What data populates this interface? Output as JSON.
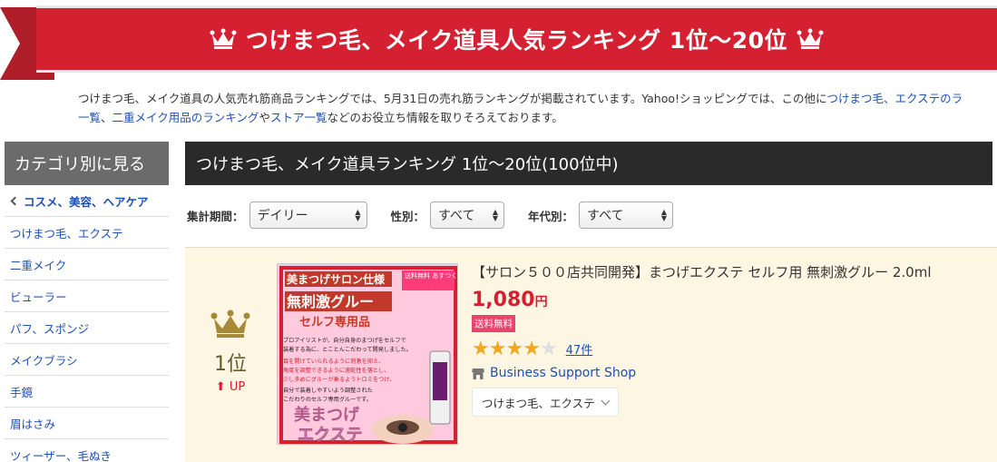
{
  "banner": {
    "title": "つけまつ毛、メイク道具人気ランキング 1位〜20位"
  },
  "description": {
    "line1_text": "つけまつ毛、メイク道具の人気売れ筋商品ランキングでは、5月31日の売れ筋ランキングが掲載されています。Yahoo!ショッピングでは、この他に",
    "line1_link": "つけまつ毛、エクステのラ",
    "line2_link1": "一覧",
    "line2_sep": "、",
    "line2_link2": "二重メイク用品のランキング",
    "line2_mid": "や",
    "line2_link3": "ストア一覧",
    "line2_tail": "などのお役立ち情報を取りそろえております。"
  },
  "sidebar": {
    "heading": "カテゴリ別に見る",
    "parent": "コスメ、美容、ヘアケア",
    "items": [
      "つけまつ毛、エクステ",
      "二重メイク",
      "ビューラー",
      "パフ、スポンジ",
      "メイクブラシ",
      "手鏡",
      "眉はさみ",
      "ツィーザー、毛ぬき"
    ]
  },
  "main": {
    "heading": "つけまつ毛、メイク道具ランキング 1位〜20位(100位中)"
  },
  "filters": {
    "period_label": "集計期間：",
    "period_value": "デイリー",
    "gender_label": "性別：",
    "gender_value": "すべて",
    "age_label": "年代別：",
    "age_value": "すべて"
  },
  "item": {
    "rank": "1位",
    "rank_change": "UP",
    "title": "【サロン５００店共同開発】まつげエクステ セルフ用 無刺激グルー 2.0ml",
    "price": "1,080",
    "price_unit": "円",
    "shipping_badge": "送料無料",
    "rating": 4,
    "rating_max": 5,
    "review_count": "47件",
    "shop_name": "Business Support Shop",
    "category_tag": "つけまつ毛、エクステ",
    "image": {
      "top_label": "美まつげサロン仕様",
      "side_label": "送料無料 あすつく対応",
      "headline": "無刺激グルー",
      "subhead": "セルフ専用品",
      "body1": "プロアイリストが、自分自身のまつげをセルフで",
      "body2": "装着する為に、とことんこだわって開発しました。",
      "body3": "目を開けていられるように刺激を抑え、",
      "body4": "角度を調整できるように速乾性を落とし、",
      "body5": "少し多めにグルーが乗るようトロミをつけ、",
      "body6": "自分で装着しやすいよう調整された",
      "body7": "こだわりのセルフ専用グルーです。",
      "brand1": "美まつげ",
      "brand2": "エクステ"
    }
  },
  "colors": {
    "banner_red": "#d42030",
    "link_blue": "#1e50b4",
    "price_red": "#d42030",
    "item_bg": "#fdf6e3",
    "star": "#f0a820",
    "header_dark": "#2a2a2a",
    "sidebar_head": "#6b6b6b"
  },
  "icons": {
    "banner": "crown-icon",
    "rank": "crown-icon",
    "rank_change": "arrow-up-icon",
    "shop": "store-icon"
  }
}
